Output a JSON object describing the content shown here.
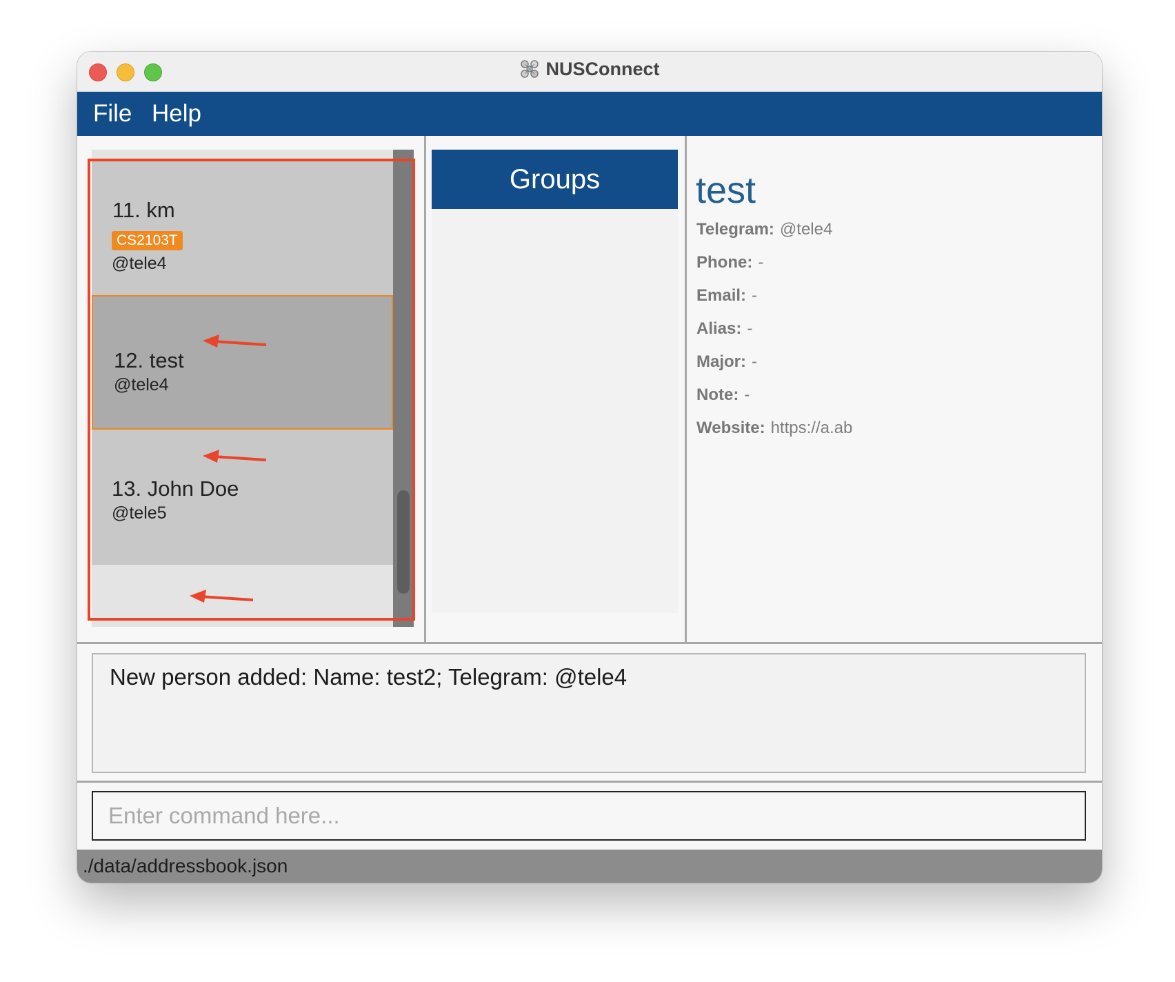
{
  "window": {
    "title": "NUSConnect"
  },
  "menu": {
    "file": "File",
    "help": "Help"
  },
  "persons": [
    {
      "name": "11. km",
      "tag": "CS2103T",
      "handle": "@tele4"
    },
    {
      "name": "12. test",
      "handle": "@tele4"
    },
    {
      "name": "13. John Doe",
      "handle": "@tele5"
    }
  ],
  "groups": {
    "header": "Groups"
  },
  "detail": {
    "name": "test",
    "fields": [
      {
        "label": "Telegram:",
        "value": "@tele4"
      },
      {
        "label": "Phone:",
        "value": "-"
      },
      {
        "label": "Email:",
        "value": "-"
      },
      {
        "label": "Alias:",
        "value": "-"
      },
      {
        "label": "Major:",
        "value": "-"
      },
      {
        "label": "Note:",
        "value": "-"
      },
      {
        "label": "Website:",
        "value": "https://a.ab"
      }
    ]
  },
  "result": {
    "text": "New person added: Name: test2; Telegram: @tele4"
  },
  "command": {
    "placeholder": "Enter command here...",
    "value": ""
  },
  "status": {
    "path": "./data/addressbook.json"
  },
  "colors": {
    "accent": "#124d8a",
    "tag": "#f0891f",
    "annotation": "#e9452a",
    "selected_border": "#e8892a"
  }
}
